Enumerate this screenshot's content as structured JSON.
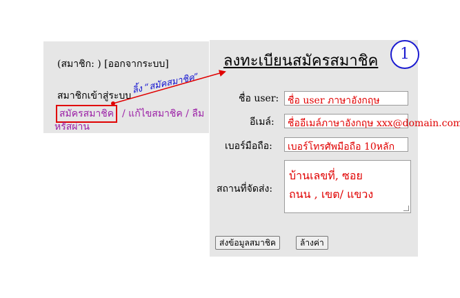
{
  "sidebar": {
    "member_status": "(สมาชิก: ) [ออกจากระบบ]",
    "login_label": "สมาชิกเข้าสู่ระบบ",
    "register_link": "สมัครสมาชิค",
    "separator": "/",
    "edit_link": "แก้ไขสมาชิค",
    "forgot_link_line1": "ลืม",
    "forgot_link_line2": "หรัสผ่าน",
    "annotation": "ลิ้ง “สมัคสมาชิค”"
  },
  "form": {
    "title": "ลงทะเบียนสมัครสมาชิค",
    "badge": "1",
    "username_label": "ชื่อ user:",
    "username_value": "ชื่อ user ภาษาอังกฤษ",
    "email_label": "อีเมล์:",
    "email_value": "ชื่ออีเมล์ภาษาอังกฤษ xxx@domain.com",
    "phone_label": "เบอร์มือถือ:",
    "phone_value": "เบอร์โทรศัพมือถือ 10หลัก",
    "address_label": "สถานที่จัดส่ง:",
    "address_line1": "บ้านเลขที่, ซอย",
    "address_line2": "ถนน , เขต/ แขวง",
    "submit_label": "ส่งข้อมูลสมาชิค",
    "reset_label": "ล้างค่า"
  },
  "colors": {
    "panel_bg": "#e6e6e6",
    "link": "#9b1fa6",
    "annotation_red": "#e00000",
    "annotation_blue": "#1a1ad0"
  }
}
